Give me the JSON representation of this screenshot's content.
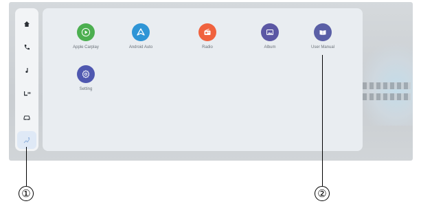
{
  "sidebar": {
    "items": [
      {
        "icon": "home-icon"
      },
      {
        "icon": "phone-icon"
      },
      {
        "icon": "music-note-icon"
      },
      {
        "icon": "seat-heat-icon"
      },
      {
        "icon": "car-settings-icon"
      },
      {
        "icon": "apps-grid-icon",
        "active": true
      }
    ]
  },
  "apps": [
    {
      "label": "Apple Carplay",
      "icon": "play-icon",
      "color": "#4caf50"
    },
    {
      "label": "Android Auto",
      "icon": "android-auto-icon",
      "color": "#2f95d6"
    },
    {
      "label": "Radio",
      "icon": "radio-icon",
      "color": "#f0623e"
    },
    {
      "label": "Album",
      "icon": "image-icon",
      "color": "#5b57a4"
    },
    {
      "label": "User Manual",
      "icon": "book-icon",
      "color": "#5a5fa6"
    },
    {
      "label": "Setting",
      "icon": "gear-icon",
      "color": "#4f58b0"
    }
  ],
  "callouts": {
    "one": "①",
    "two": "②"
  }
}
